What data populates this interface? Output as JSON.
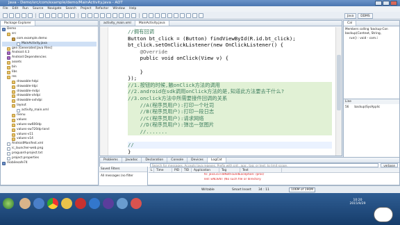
{
  "window": {
    "title": "Java - Demo/src/com/example/demo/MainActivity.java - ADT"
  },
  "menu": [
    "File",
    "Edit",
    "Run",
    "Source",
    "Navigate",
    "Search",
    "Project",
    "Refactor",
    "Window",
    "Help"
  ],
  "perspectives": [
    "Java",
    "DDMS"
  ],
  "explorer": {
    "tab_label": "Package Explorer",
    "items": [
      "Demo",
      "src",
      "com.example.demo",
      "MainActivity.java",
      "gen [Generated Java Files]",
      "Android 4.3",
      "Android Dependencies",
      "assets",
      "bin",
      "libs",
      "res",
      "drawable-hdpi",
      "drawable-ldpi",
      "drawable-mdpi",
      "drawable-xhdpi",
      "drawable-xxhdpi",
      "layout",
      "activity_main.xml",
      "menu",
      "values",
      "values-sw600dp",
      "values-sw720dp-land",
      "values-v11",
      "values-v14",
      "AndroidManifest.xml",
      "ic_launcher-web.png",
      "proguard-project.txt",
      "project.properties",
      "mobilesafe74"
    ]
  },
  "editor": {
    "tabs": [
      "activity_main.xml",
      "MainActivity.java"
    ],
    "lines": [
      {
        "t": "//拥有回调",
        "c": "cm"
      },
      {
        "t": "Button bt_click = (Button) findViewById(R.id.bt_click);",
        "c": ""
      },
      {
        "t": "bt_click.setOnClickListener(new OnClickListener() {",
        "c": ""
      },
      {
        "t": "    @Override",
        "c": "an"
      },
      {
        "t": "    public void onClick(View v) {",
        "c": ""
      },
      {
        "t": "",
        "c": ""
      },
      {
        "t": "    }",
        "c": ""
      },
      {
        "t": "});",
        "c": ""
      },
      {
        "t": "//1.按钮的时候,触onClick方法的调用",
        "c": "cm"
      },
      {
        "t": "//2.android在sdk调用onClick方法的是,知道此方法要去干什么?",
        "c": "cm"
      },
      {
        "t": "//3.onclick方法中所需要接件回调的关系",
        "c": "cm"
      },
      {
        "t": "    //A(程序员用户):打印一个吐司",
        "c": "cm"
      },
      {
        "t": "    //B(程序员用户):打印一段日志",
        "c": "cm"
      },
      {
        "t": "    //C(程序员用户):请求网络",
        "c": "cm"
      },
      {
        "t": "    //D(程序员用户):弹出一张图片",
        "c": "cm"
      },
      {
        "t": "    //.......",
        "c": "cm"
      },
      {
        "t": "",
        "c": ""
      },
      {
        "t": "//",
        "c": "cm"
      },
      {
        "t": "}",
        "c": ""
      }
    ]
  },
  "outline": {
    "tabs": [
      "Members calling 'backup-Con"
    ],
    "items": [
      "backup(Context, String,",
      "run() : void - com.i"
    ],
    "bottom_tab": "Line",
    "bottom_items": [
      [
        "56",
        "backup(SysApplic"
      ]
    ]
  },
  "bottom": {
    "tabs": [
      "Problems",
      "Javadoc",
      "Declaration",
      "Console",
      "Devices",
      "LogCat"
    ],
    "filters_label": "Saved Filters",
    "all_messages": "All messages (no filter",
    "search_placeholder": "Search for messages. Accepts Java regexes. Prefix with pid:, app:, tag: or text: to limit scope.",
    "level": "verbose",
    "columns": [
      "L",
      "Time",
      "PID",
      "TID",
      "Application",
      "Tag",
      "Text"
    ],
    "log_lines": [
      "ts: java.io.FileNotFoundException: /proc/",
      "led: ENOENT (No such file or directory"
    ]
  },
  "status": {
    "mode": "Writable",
    "insert": "Smart Insert",
    "position": "34 : 11",
    "memory": "106M of 190M"
  },
  "taskbar": {
    "time": "10:20",
    "date": "2015/9/29"
  }
}
